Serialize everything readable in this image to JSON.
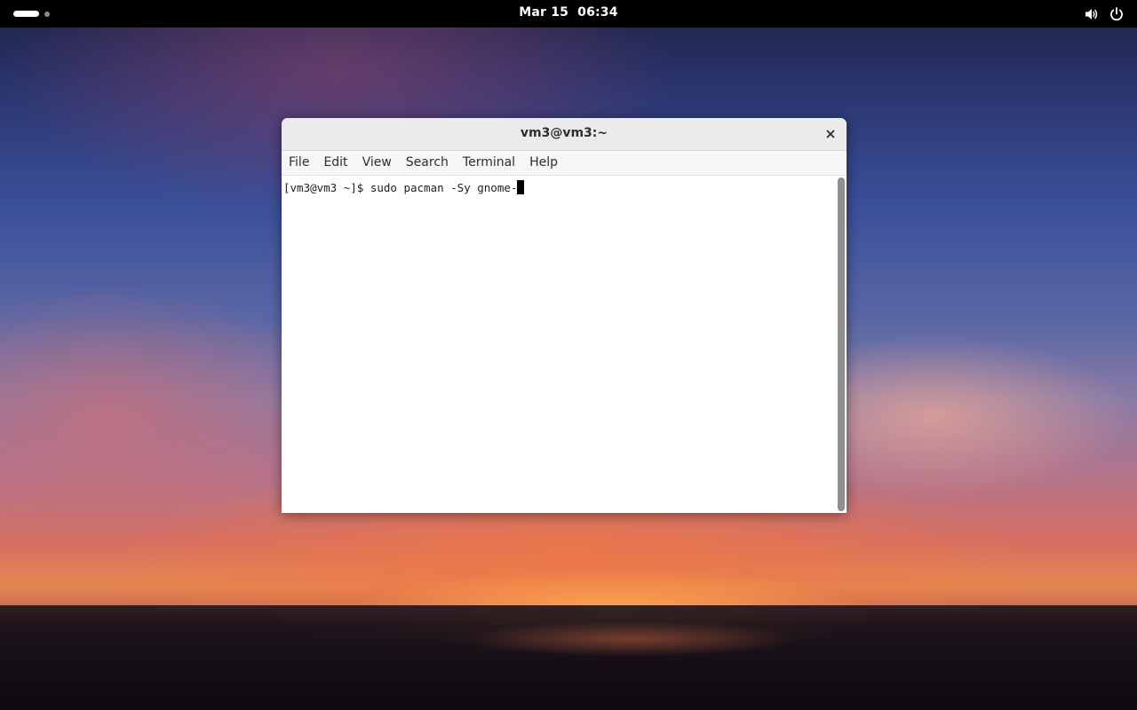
{
  "topbar": {
    "date": "Mar 15",
    "time": "06:34",
    "workspace_count": 2,
    "active_workspace": 1,
    "icons": [
      "volume-icon",
      "power-icon"
    ]
  },
  "window": {
    "title": "vm3@vm3:~",
    "close_icon": "close-icon",
    "menu": [
      "File",
      "Edit",
      "View",
      "Search",
      "Terminal",
      "Help"
    ],
    "terminal": {
      "prompt": "[vm3@vm3 ~]$ ",
      "command": "sudo pacman -Sy gnome-"
    },
    "scroll_position": 1.0
  },
  "colors": {
    "topbar_bg": "#000000",
    "titlebar_bg": "#ebebeb",
    "terminal_bg": "#ffffff",
    "scrollbar_thumb": "#8f8f8f"
  }
}
